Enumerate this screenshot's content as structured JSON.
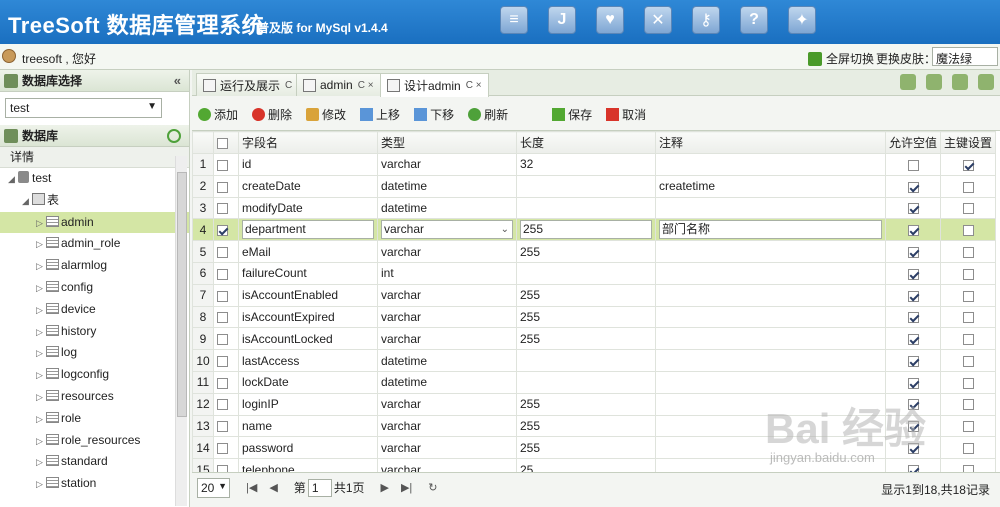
{
  "app": {
    "title": "TreeSoft 数据库管理系统",
    "edition": "普及版 for MySql v1.4.4",
    "top_icons": [
      "database-icon",
      "j-icon",
      "heart-icon",
      "tools-icon",
      "key-icon",
      "help-icon",
      "runner-icon"
    ],
    "top_icon_glyphs": [
      "≡",
      "J",
      "♥",
      "✕",
      "⚷",
      "?",
      "✦"
    ]
  },
  "userbar": {
    "user_text": "treesoft , 您好",
    "fullscreen_label": "全屏切换",
    "skin_label": "更换皮肤：",
    "skin_value": "魔法绿"
  },
  "left": {
    "db_select_title": "数据库选择",
    "db_selected": "test",
    "db_title": "数据库",
    "detail": "详情",
    "db_node": "test",
    "tables_node": "表",
    "tables": [
      "admin",
      "admin_role",
      "alarmlog",
      "config",
      "device",
      "history",
      "log",
      "logconfig",
      "resources",
      "role",
      "role_resources",
      "standard",
      "station"
    ]
  },
  "tabs": [
    {
      "label": "运行及展示",
      "close": "C"
    },
    {
      "label": "admin",
      "close": "C ×"
    },
    {
      "label": "设计admin",
      "close": "C ×"
    }
  ],
  "toolbar": {
    "add": "添加",
    "delete": "删除",
    "edit": "修改",
    "up": "上移",
    "down": "下移",
    "refresh": "刷新",
    "save": "保存",
    "cancel": "取消"
  },
  "grid": {
    "headers": [
      "字段名",
      "类型",
      "长度",
      "注释",
      "允许空值",
      "主键设置"
    ],
    "rows": [
      {
        "n": "1",
        "name": "id",
        "type": "varchar",
        "len": "32",
        "comment": "",
        "nullable": false,
        "pk": true
      },
      {
        "n": "2",
        "name": "createDate",
        "type": "datetime",
        "len": "",
        "comment": "createtime",
        "nullable": true,
        "pk": false
      },
      {
        "n": "3",
        "name": "modifyDate",
        "type": "datetime",
        "len": "",
        "comment": "",
        "nullable": true,
        "pk": false
      },
      {
        "n": "4",
        "name": "department",
        "type": "varchar",
        "len": "255",
        "comment": "部门名称",
        "nullable": true,
        "pk": false
      },
      {
        "n": "5",
        "name": "eMail",
        "type": "varchar",
        "len": "255",
        "comment": "",
        "nullable": true,
        "pk": false
      },
      {
        "n": "6",
        "name": "failureCount",
        "type": "int",
        "len": "",
        "comment": "",
        "nullable": true,
        "pk": false
      },
      {
        "n": "7",
        "name": "isAccountEnabled",
        "type": "varchar",
        "len": "255",
        "comment": "",
        "nullable": true,
        "pk": false
      },
      {
        "n": "8",
        "name": "isAccountExpired",
        "type": "varchar",
        "len": "255",
        "comment": "",
        "nullable": true,
        "pk": false
      },
      {
        "n": "9",
        "name": "isAccountLocked",
        "type": "varchar",
        "len": "255",
        "comment": "",
        "nullable": true,
        "pk": false
      },
      {
        "n": "10",
        "name": "lastAccess",
        "type": "datetime",
        "len": "",
        "comment": "",
        "nullable": true,
        "pk": false
      },
      {
        "n": "11",
        "name": "lockDate",
        "type": "datetime",
        "len": "",
        "comment": "",
        "nullable": true,
        "pk": false
      },
      {
        "n": "12",
        "name": "loginIP",
        "type": "varchar",
        "len": "255",
        "comment": "",
        "nullable": true,
        "pk": false
      },
      {
        "n": "13",
        "name": "name",
        "type": "varchar",
        "len": "255",
        "comment": "",
        "nullable": true,
        "pk": false
      },
      {
        "n": "14",
        "name": "password",
        "type": "varchar",
        "len": "255",
        "comment": "",
        "nullable": true,
        "pk": false
      },
      {
        "n": "15",
        "name": "telephone",
        "type": "varchar",
        "len": "25",
        "comment": "",
        "nullable": true,
        "pk": false
      }
    ],
    "selected_row": 3
  },
  "pager": {
    "page_size": "20",
    "page_prefix": "第",
    "page_value": "1",
    "page_suffix": "共1页",
    "info": "显示1到18,共18记录"
  },
  "watermark": {
    "text": "Bai 经验",
    "url": "jingyan.baidu.com"
  },
  "colors": {
    "header_blue": "#1a6fc0",
    "selected_green": "#d4e6a5"
  }
}
